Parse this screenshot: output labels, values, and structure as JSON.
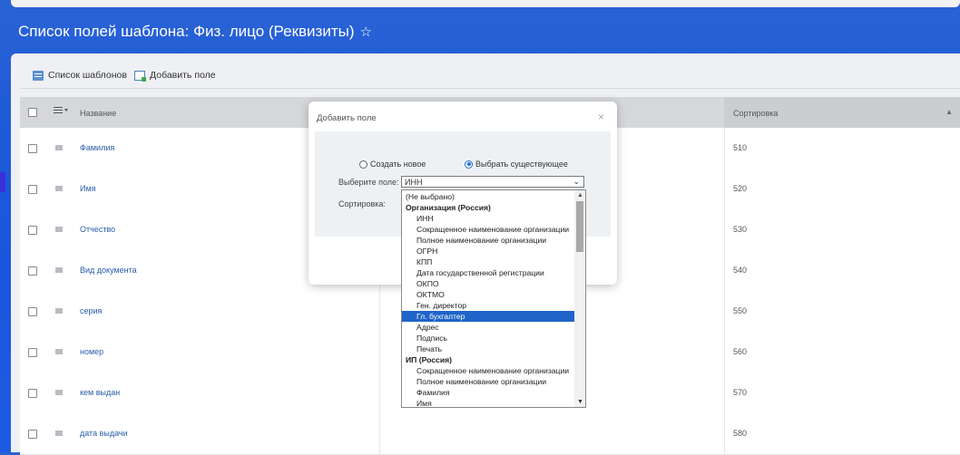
{
  "page": {
    "title": "Список полей шаблона: Физ. лицо (Реквизиты)"
  },
  "toolbar": {
    "templates_label": "Список шаблонов",
    "add_field_label": "Добавить поле"
  },
  "grid": {
    "col_name": "Название",
    "col_sort": "Сортировка",
    "rows": [
      {
        "name": "Фамилия",
        "sort": "510"
      },
      {
        "name": "Имя",
        "sort": "520"
      },
      {
        "name": "Отчество",
        "sort": "530"
      },
      {
        "name": "Вид документа",
        "sort": "540"
      },
      {
        "name": "серия",
        "sort": "550"
      },
      {
        "name": "номер",
        "sort": "560"
      },
      {
        "name": "кем выдан",
        "sort": "570"
      },
      {
        "name": "дата выдачи",
        "sort": "580"
      }
    ]
  },
  "dialog": {
    "title": "Добавить поле",
    "close": "×",
    "radio_new": "Создать новое",
    "radio_existing": "Выбрать существующее",
    "field_label": "Выберите поле:",
    "field_value": "ИНН",
    "sort_label": "Сортировка:"
  },
  "dropdown": {
    "items": [
      {
        "text": "(Не выбрано)",
        "kind": "top"
      },
      {
        "text": "Организация (Россия)",
        "kind": "group"
      },
      {
        "text": "ИНН",
        "kind": "opt"
      },
      {
        "text": "Сокращенное наименование организации",
        "kind": "opt"
      },
      {
        "text": "Полное наименование организации",
        "kind": "opt"
      },
      {
        "text": "ОГРН",
        "kind": "opt"
      },
      {
        "text": "КПП",
        "kind": "opt"
      },
      {
        "text": "Дата государственной регистрации",
        "kind": "opt"
      },
      {
        "text": "ОКПО",
        "kind": "opt"
      },
      {
        "text": "ОКТМО",
        "kind": "opt"
      },
      {
        "text": "Ген. директор",
        "kind": "opt"
      },
      {
        "text": "Гл. бухгалтер",
        "kind": "opt",
        "selected": true
      },
      {
        "text": "Адрес",
        "kind": "opt"
      },
      {
        "text": "Подпись",
        "kind": "opt"
      },
      {
        "text": "Печать",
        "kind": "opt"
      },
      {
        "text": "ИП (Россия)",
        "kind": "group"
      },
      {
        "text": "Сокращенное наименование организации",
        "kind": "opt"
      },
      {
        "text": "Полное наименование организации",
        "kind": "opt"
      },
      {
        "text": "Фамилия",
        "kind": "opt"
      },
      {
        "text": "Имя",
        "kind": "opt"
      }
    ]
  },
  "colors": {
    "background": "#1d5ce2",
    "highlight": "#1f64c8",
    "link": "#2a5ca8"
  }
}
